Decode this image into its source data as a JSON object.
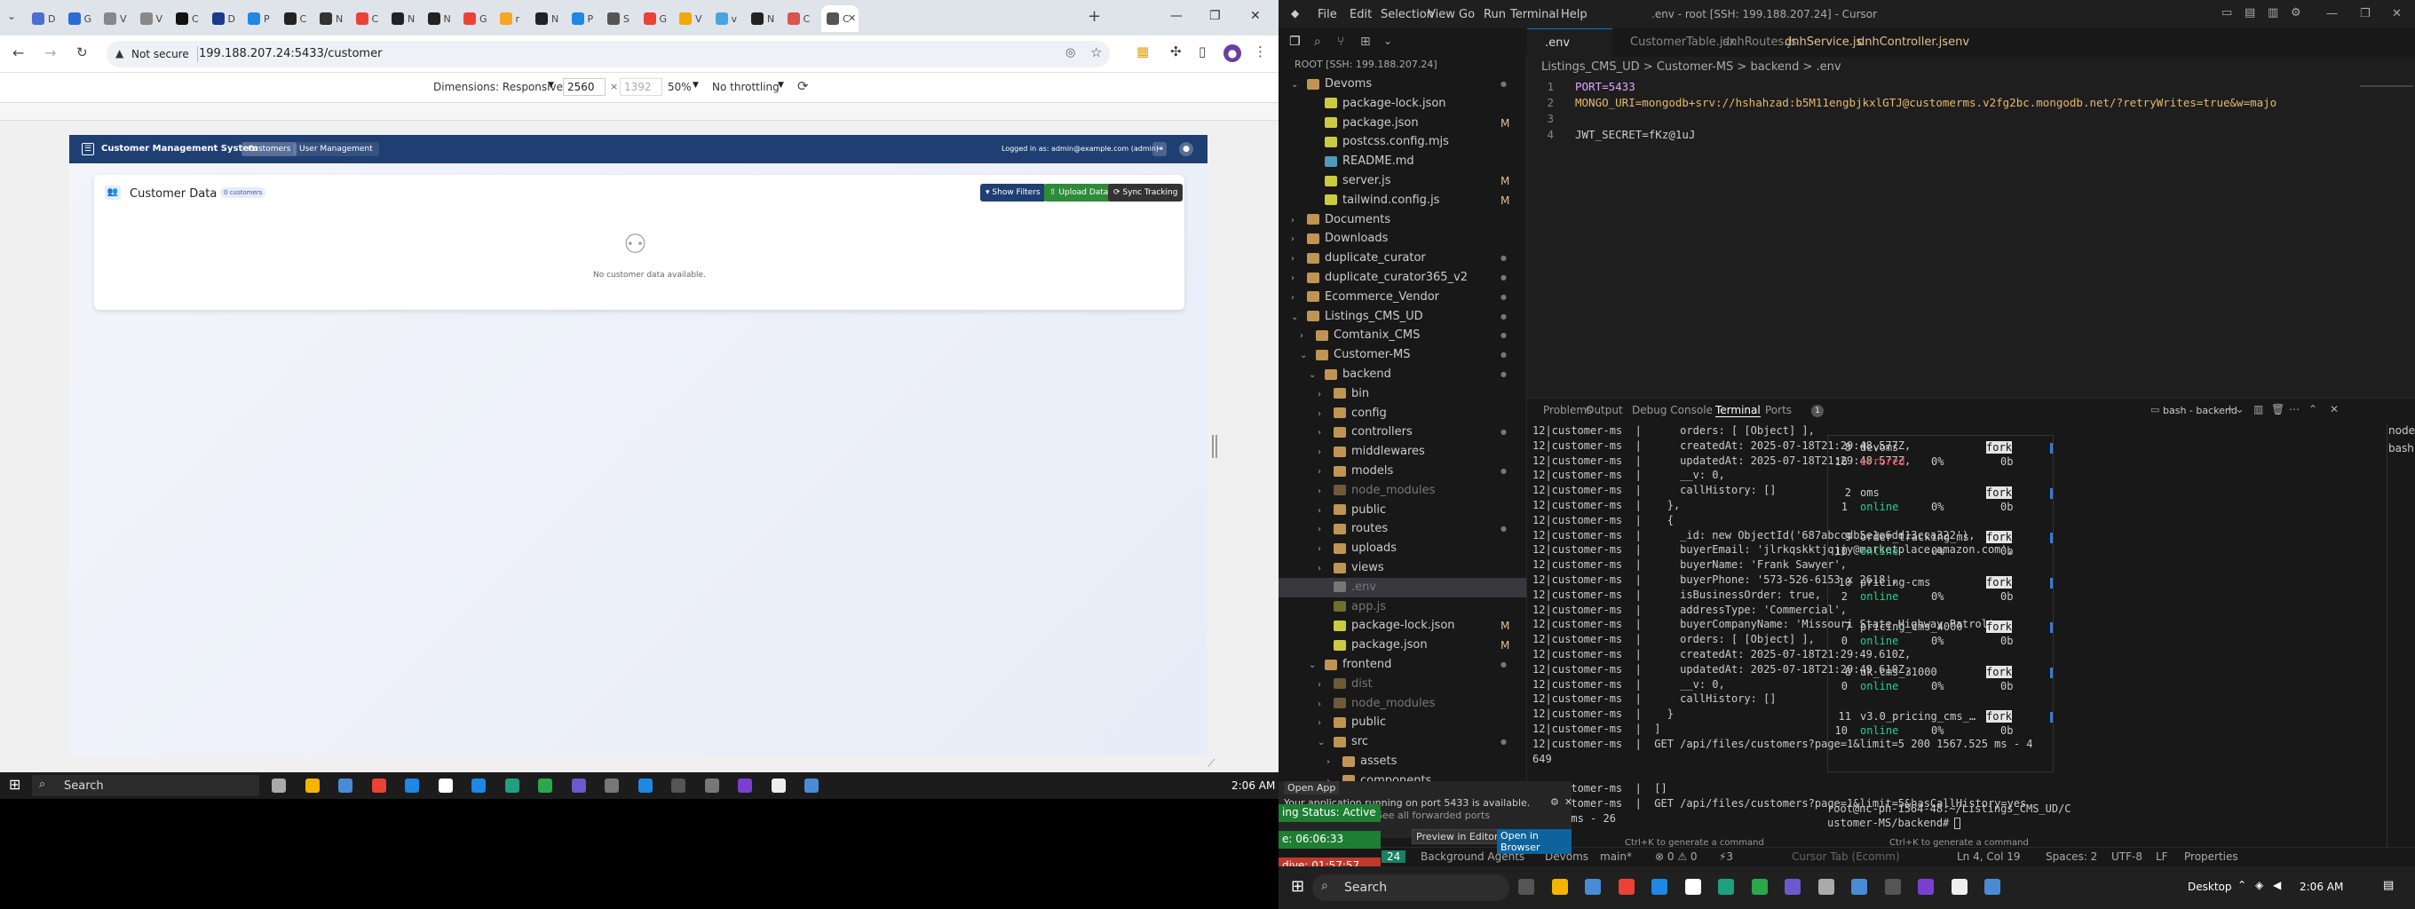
{
  "browser": {
    "tabs": [
      "D",
      "G",
      "V",
      "V",
      "C",
      "D",
      "P",
      "C",
      "N",
      "C",
      "N",
      "N",
      "G",
      "r",
      "N",
      "P",
      "S",
      "G",
      "V",
      "v",
      "N",
      "C",
      "C"
    ],
    "active_tab_title": "C",
    "window_controls": {
      "minimize": "—",
      "maximize": "❐",
      "close": "✕"
    },
    "address": {
      "security_label": "Not secure",
      "url": "199.188.207.24:5433/customer"
    },
    "devtools": {
      "dimensions_label": "Dimensions: Responsive",
      "width": "2560",
      "height_placeholder": "1392",
      "zoom": "50%",
      "throttling": "No throttling"
    }
  },
  "app": {
    "brand": "Customer Management System",
    "nav": [
      "Customers",
      "User Management"
    ],
    "logged_in": "Logged in as: admin@example.com (admin)",
    "card_title": "Customer Data",
    "count_badge": "0 customers",
    "buttons": {
      "filters": "Show Filters",
      "upload": "Upload Data",
      "sync": "Sync Tracking"
    },
    "empty_message": "No customer data available."
  },
  "taskbar_left": {
    "search": "Search",
    "clock": "2:06 AM"
  },
  "cursor": {
    "window_title": ".env - root [SSH: 199.188.207.24] - Cursor",
    "menus": [
      "File",
      "Edit",
      "Selection",
      "View",
      "Go",
      "Run",
      "Terminal",
      "Help"
    ],
    "explorer_root": "ROOT [SSH: 199.188.207.24]",
    "tree": [
      {
        "label": "Devoms",
        "indent": 0,
        "type": "folder-open",
        "mark": "dot"
      },
      {
        "label": "package-lock.json",
        "indent": 2,
        "type": "json",
        "mark": ""
      },
      {
        "label": "package.json",
        "indent": 2,
        "type": "json",
        "mark": "M"
      },
      {
        "label": "postcss.config.mjs",
        "indent": 2,
        "type": "js",
        "mark": ""
      },
      {
        "label": "README.md",
        "indent": 2,
        "type": "info",
        "mark": ""
      },
      {
        "label": "server.js",
        "indent": 2,
        "type": "js",
        "mark": "M"
      },
      {
        "label": "tailwind.config.js",
        "indent": 2,
        "type": "js",
        "mark": "M"
      },
      {
        "label": "Documents",
        "indent": 0,
        "type": "folder",
        "mark": ""
      },
      {
        "label": "Downloads",
        "indent": 0,
        "type": "folder",
        "mark": ""
      },
      {
        "label": "duplicate_curator",
        "indent": 0,
        "type": "folder",
        "mark": "dot"
      },
      {
        "label": "duplicate_curator365_v2",
        "indent": 0,
        "type": "folder",
        "mark": "dot"
      },
      {
        "label": "Ecommerce_Vendor",
        "indent": 0,
        "type": "folder",
        "mark": "dot"
      },
      {
        "label": "Listings_CMS_UD",
        "indent": 0,
        "type": "folder-open",
        "mark": "dot"
      },
      {
        "label": "Comtanix_CMS",
        "indent": 1,
        "type": "folder",
        "mark": "dot"
      },
      {
        "label": "Customer-MS",
        "indent": 1,
        "type": "folder-open",
        "mark": "dot"
      },
      {
        "label": "backend",
        "indent": 2,
        "type": "folder-open",
        "mark": "dot"
      },
      {
        "label": "bin",
        "indent": 3,
        "type": "folder",
        "mark": ""
      },
      {
        "label": "config",
        "indent": 3,
        "type": "folder",
        "mark": ""
      },
      {
        "label": "controllers",
        "indent": 3,
        "type": "folder",
        "mark": "dot"
      },
      {
        "label": "middlewares",
        "indent": 3,
        "type": "folder",
        "mark": ""
      },
      {
        "label": "models",
        "indent": 3,
        "type": "folder",
        "mark": "dot"
      },
      {
        "label": "node_modules",
        "indent": 3,
        "type": "folder-dim",
        "mark": ""
      },
      {
        "label": "public",
        "indent": 3,
        "type": "folder",
        "mark": ""
      },
      {
        "label": "routes",
        "indent": 3,
        "type": "folder",
        "mark": "dot"
      },
      {
        "label": "uploads",
        "indent": 3,
        "type": "folder",
        "mark": ""
      },
      {
        "label": "views",
        "indent": 3,
        "type": "folder",
        "mark": ""
      },
      {
        "label": ".env",
        "indent": 3,
        "type": "env-sel",
        "mark": ""
      },
      {
        "label": "app.js",
        "indent": 3,
        "type": "js-dim",
        "mark": ""
      },
      {
        "label": "package-lock.json",
        "indent": 3,
        "type": "json",
        "mark": "M"
      },
      {
        "label": "package.json",
        "indent": 3,
        "type": "json",
        "mark": "M"
      },
      {
        "label": "frontend",
        "indent": 2,
        "type": "folder-open",
        "mark": "dot"
      },
      {
        "label": "dist",
        "indent": 3,
        "type": "folder-dim",
        "mark": ""
      },
      {
        "label": "node_modules",
        "indent": 3,
        "type": "folder-dim",
        "mark": ""
      },
      {
        "label": "public",
        "indent": 3,
        "type": "folder",
        "mark": ""
      },
      {
        "label": "src",
        "indent": 3,
        "type": "folder-open",
        "mark": "dot"
      },
      {
        "label": "assets",
        "indent": 4,
        "type": "folder",
        "mark": ""
      },
      {
        "label": "components",
        "indent": 4,
        "type": "folder",
        "mark": ""
      }
    ],
    "editor_tabs": [
      {
        "label": ".env ~/.../backend",
        "active": true
      },
      {
        "label": "CustomerTable.jsx",
        "active": false
      },
      {
        "label": "dnhRoutes.js",
        "active": false
      },
      {
        "label": "dnhService.js M",
        "active": false
      },
      {
        "label": "dnhController.js M",
        "active": false
      },
      {
        "label": ".env ~/Devoms",
        "active": false
      }
    ],
    "breadcrumb": "Listings_CMS_UD > Customer-MS > backend > .env",
    "code": [
      {
        "n": "1",
        "text": "PORT=5433"
      },
      {
        "n": "2",
        "text": "MONGO_URI=mongodb+srv://hshahzad:b5M11engbjkxlGTJ@customerms.v2fg2bc.mongodb.net/?retryWrites=true&w=majo"
      },
      {
        "n": "3",
        "text": ""
      },
      {
        "n": "4",
        "text": "JWT_SECRET=fKz@1uJ"
      }
    ],
    "panel_tabs": [
      "Problems",
      "Output",
      "Debug Console",
      "Terminal",
      "Ports"
    ],
    "ports_badge": "1",
    "terminal_name": "bash - backend",
    "terminal_lines": [
      "12|customer-ms  |      orders: [ [Object] ],",
      "12|customer-ms  |      createdAt: 2025-07-18T21:29:48.577Z,",
      "12|customer-ms  |      updatedAt: 2025-07-18T21:29:48.577Z,",
      "12|customer-ms  |      __v: 0,",
      "12|customer-ms  |      callHistory: []",
      "12|customer-ms  |    },",
      "12|customer-ms  |    {",
      "12|customer-ms  |      _id: new ObjectId('687abccdb5e1e6dd13cca322'),",
      "12|customer-ms  |      buyerEmail: 'jlrkqskktjqjjy@marketplace.amazon.com',",
      "12|customer-ms  |      buyerName: 'Frank Sawyer',",
      "12|customer-ms  |      buyerPhone: '573-526-6153 x 2618',",
      "12|customer-ms  |      isBusinessOrder: true,",
      "12|customer-ms  |      addressType: 'Commercial',",
      "12|customer-ms  |      buyerCompanyName: 'Missouri State Highway Patrol',",
      "12|customer-ms  |      orders: [ [Object] ],",
      "12|customer-ms  |      createdAt: 2025-07-18T21:29:49.610Z,",
      "12|customer-ms  |      updatedAt: 2025-07-18T21:29:49.610Z,",
      "12|customer-ms  |      __v: 0,",
      "12|customer-ms  |      callHistory: []",
      "12|customer-ms  |    }",
      "12|customer-ms  |  ]",
      "12|customer-ms  |  GET /api/files/customers?page=1&limit=5 200 1567.525 ms - 4",
      "649",
      "",
      "12|customer-ms  |  []",
      "12|customer-ms  |  GET /api/files/customers?page=1&limit=5&hasCallHistory=yes",
      " .548 ms - 26"
    ],
    "pm2": [
      {
        "id": "8",
        "restarts": "16",
        "name": "devoms",
        "status": "errored",
        "cpu": "0%",
        "mode": "fork",
        "mem": "0b"
      },
      {
        "id": "2",
        "restarts": "1",
        "name": "oms",
        "status": "online",
        "cpu": "0%",
        "mode": "fork",
        "mem": "0b"
      },
      {
        "id": "9",
        "restarts": "10",
        "name": "order_tracking_ms",
        "status": "online",
        "cpu": "0%",
        "mode": "fork",
        "mem": "0b"
      },
      {
        "id": "10",
        "restarts": "2",
        "name": "pricing-cms",
        "status": "online",
        "cpu": "0%",
        "mode": "fork",
        "mem": "0b"
      },
      {
        "id": "7",
        "restarts": "0",
        "name": "pricing_cms_4000",
        "status": "online",
        "cpu": "0%",
        "mode": "fork",
        "mem": "0b"
      },
      {
        "id": "6",
        "restarts": "0",
        "name": "uk_cms_31000",
        "status": "online",
        "cpu": "0%",
        "mode": "fork",
        "mem": "0b"
      },
      {
        "id": "11",
        "restarts": "10",
        "name": "v3.0_pricing_cms_…",
        "status": "online",
        "cpu": "0%",
        "mode": "fork",
        "mem": "0b"
      }
    ],
    "prompt_line1": "root@nc-ph-1564-48:~/Listings_CMS_UD/C",
    "prompt_line2": "ustomer-MS/backend# ",
    "hint1": "Ctrl+K to generate a command",
    "hint2": "Ctrl+K to generate a command",
    "terminals_list": [
      "node bac…",
      "bash back…"
    ],
    "status": {
      "remote": "24",
      "agents": "Background Agents",
      "project": "Devoms",
      "branch": "main*",
      "problems": "⊗ 0 ⚠ 0",
      "ports": "⚡3",
      "cursor_tab": "Cursor Tab (Ecomm)",
      "position": "Ln 4, Col 19",
      "spaces": "Spaces: 2",
      "encoding": "UTF-8",
      "eol": "LF",
      "properties": "Properties"
    },
    "notification": {
      "open_app": "Open App",
      "line1": "Your application running on port 5433 is available.",
      "line2": "See all forwarded ports",
      "preview": "Preview in Editor",
      "open_browser": "Open in Browser"
    },
    "timers": {
      "status": "ing Status: Active",
      "t1": "e: 06:06:33",
      "t2": "dive: 01:57:57"
    }
  },
  "taskbar_right": {
    "search": "Search",
    "desktop": "Desktop",
    "clock": "2:06 AM"
  }
}
